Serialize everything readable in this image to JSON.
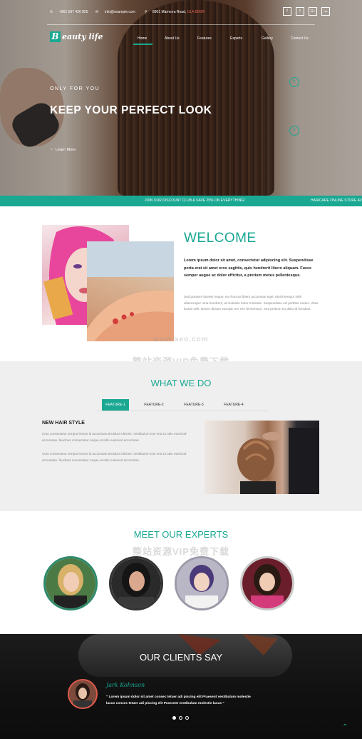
{
  "topbar": {
    "phone": "+861 597 420 825",
    "email": "info@example.com",
    "address": "8901 Marmora Road, ",
    "address_highlight": "GLA 8DBR",
    "social": [
      "f",
      "t",
      "G+",
      "rss"
    ]
  },
  "brand": {
    "logo_letter": "B",
    "logo_text": "eauty life"
  },
  "nav": [
    "Home",
    "About Us",
    "Features",
    "Experts",
    "Gallery",
    "Contact Us"
  ],
  "hero": {
    "kicker": "ONLY FOR YOU",
    "headline": "KEEP YOUR PERFECT LOOK",
    "cta": "Learn More"
  },
  "ticker": {
    "promo": "JOIN OUR DISCOUNT CLUB & SAVE 25% ON EVERYTHING!",
    "store": "HAIRCARE ONLINE STORE AV"
  },
  "welcome": {
    "title": "WELCOME",
    "lead": "Lorem ipsum dolor sit amet, consectetur adipiscing elit. Suspendisse porta erat sit amet eros sagittis, quis hendrerit libero aliquam. Fusce semper augue ac dolor efficitur, a pretium metus pellentesque.",
    "body": "Sed posuere laoreet neque, eu rhoncus libero accumsan eget. Morbi tempor nibh ullamcorper urna hendrerit, at molestie tortor molestie. Suspendisse vel porttitor metus. Vitae luctus velit. Donec dictum suscipit orci nec fermentum. Sed pretium eu diam id tincidunt."
  },
  "whatwedo": {
    "title": "WHAT WE DO",
    "tabs": [
      "FEATURE-1",
      "FEATURE-2",
      "FEATURE-3",
      "FEATURE-4"
    ],
    "active_tab": "FEATURE-1",
    "heading": "NEW HAIR STYLE",
    "p1": "Cras consectetur tempus lectus id accumsan.tincidunt ultrices. Vestibulum non erat ut odio euismod accumsan. faucibus consectetur neque ut odio euismod accumsan.",
    "p2": "Cras consectetur tempus lectus id accumsan.tincidunt ultrices. Vestibulum non erat ut odio euismod accumsan. faucibus consectetur neque ut odio euismod accumsan."
  },
  "experts": {
    "title": "MEET OUR EXPERTS"
  },
  "clients": {
    "title": "OUR CLIENTS SAY",
    "name": "Jark Kohnson",
    "quote": "\" Lorem ipsum dolor sit amet consec tetuer adi piscing elit Praesent vestibulum molestie lacus consec tetuer adi piscing elit Praesent vestibulum molestie lacus \""
  },
  "watermark": {
    "url": "www.seo.com",
    "text": "整站资源VIP免费下载"
  },
  "colors": {
    "accent": "#1aa892",
    "dark": "#111111",
    "light_section": "#efefef"
  }
}
